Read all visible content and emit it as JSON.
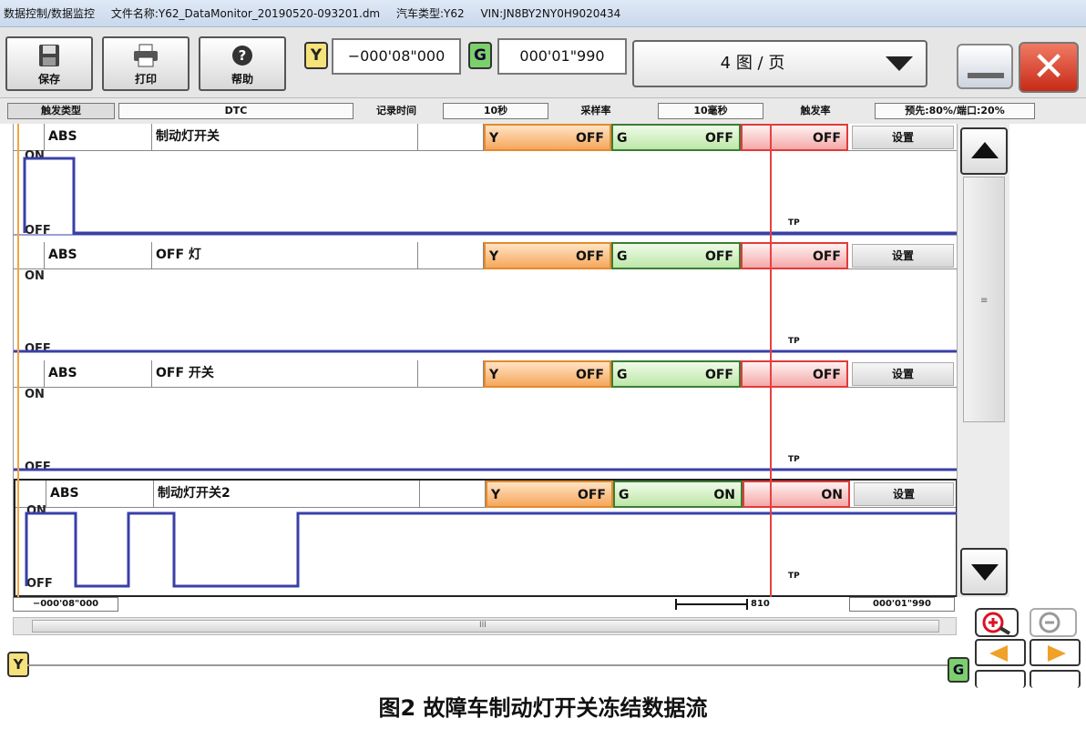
{
  "titlebar": {
    "module": "数据控制/数据监控",
    "file": "文件名称:Y62_DataMonitor_20190520-093201.dm",
    "vehicle": "汽车类型:Y62",
    "vin": "VIN:JN8BY2NY0H9020434"
  },
  "toolbar": {
    "save_label": "保存",
    "print_label": "打印",
    "help_label": "帮助",
    "marker_y": "Y",
    "marker_g": "G",
    "time_y": "−000'08\"000",
    "time_g": "000'01\"990",
    "page_select": "4 图 / 页",
    "close_glyph": "✕"
  },
  "info": {
    "trigger_type_label": "触发类型",
    "trigger_type_value": "DTC",
    "record_time_label": "记录时间",
    "record_time_value": "10秒",
    "sample_rate_label": "采样率",
    "sample_rate_value": "10毫秒",
    "trigger_rate_label": "触发率",
    "trigger_rate_value": "预先:80%/端口:20%"
  },
  "panels": [
    {
      "system": "ABS",
      "signal": "制动灯开关",
      "y_label": "Y",
      "y_value": "OFF",
      "g_label": "G",
      "g_value": "OFF",
      "r_value": "OFF",
      "settings": "设置",
      "on": "ON",
      "off": "OFF",
      "tp": "TP"
    },
    {
      "system": "ABS",
      "signal": "OFF 灯",
      "y_label": "Y",
      "y_value": "OFF",
      "g_label": "G",
      "g_value": "OFF",
      "r_value": "OFF",
      "settings": "设置",
      "on": "ON",
      "off": "OFF",
      "tp": "TP"
    },
    {
      "system": "ABS",
      "signal": "OFF 开关",
      "y_label": "Y",
      "y_value": "OFF",
      "g_label": "G",
      "g_value": "OFF",
      "r_value": "OFF",
      "settings": "设置",
      "on": "ON",
      "off": "OFF",
      "tp": "TP"
    },
    {
      "system": "ABS",
      "signal": "制动灯开关2",
      "y_label": "Y",
      "y_value": "OFF",
      "g_label": "G",
      "g_value": "ON",
      "r_value": "ON",
      "settings": "设置",
      "on": "ON",
      "off": "OFF",
      "tp": "TP"
    }
  ],
  "axis": {
    "start": "−000'08\"000",
    "marker": "810",
    "end": "000'01\"990"
  },
  "hscroll_grip": "III",
  "vscroll_grip": "≡",
  "caption": "图2 故障车制动灯开关冻结数据流",
  "colors": {
    "signal_line": "#3a3fa8",
    "y_cursor": "#f2a440",
    "red_cursor": "#e84040"
  }
}
